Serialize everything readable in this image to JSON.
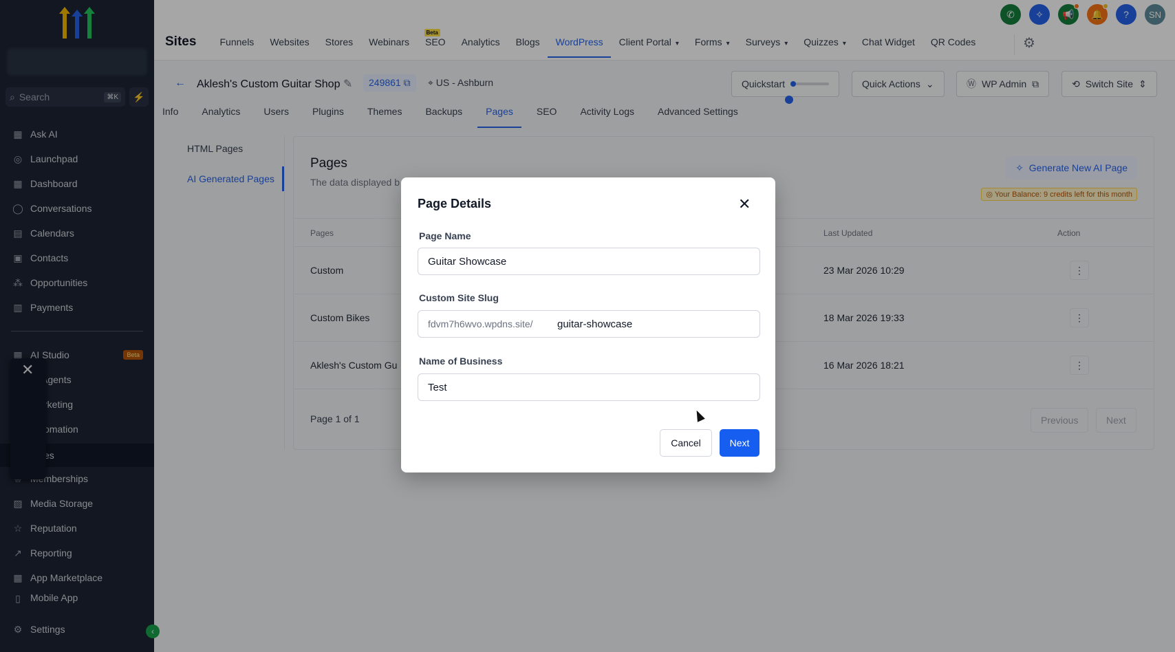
{
  "sidebar": {
    "search_placeholder": "Search",
    "search_shortcut": "⌘K",
    "items": [
      {
        "label": "Ask AI",
        "icon": "grid-icon"
      },
      {
        "label": "Launchpad",
        "icon": "rocket-icon"
      },
      {
        "label": "Dashboard",
        "icon": "grid-icon"
      },
      {
        "label": "Conversations",
        "icon": "chat-icon"
      },
      {
        "label": "Calendars",
        "icon": "calendar-icon"
      },
      {
        "label": "Contacts",
        "icon": "contacts-icon"
      },
      {
        "label": "Opportunities",
        "icon": "opportunities-icon"
      },
      {
        "label": "Payments",
        "icon": "payments-icon"
      }
    ],
    "ai_studio": {
      "label": "AI Studio",
      "badge": "Beta"
    },
    "partial_items": [
      "Agents",
      "rketing",
      "omation",
      "es"
    ],
    "items2": [
      {
        "label": "Memberships",
        "icon": "membership-icon"
      },
      {
        "label": "Media Storage",
        "icon": "image-icon"
      },
      {
        "label": "Reputation",
        "icon": "star-icon"
      },
      {
        "label": "Reporting",
        "icon": "chart-icon"
      },
      {
        "label": "App Marketplace",
        "icon": "grid-icon"
      },
      {
        "label": "Mobile App",
        "icon": "mobile-icon"
      }
    ],
    "settings": "Settings"
  },
  "topbar": {
    "title": "Sites",
    "tabs": [
      {
        "label": "Funnels"
      },
      {
        "label": "Websites"
      },
      {
        "label": "Stores"
      },
      {
        "label": "Webinars"
      },
      {
        "label": "SEO",
        "badge": "Beta"
      },
      {
        "label": "Analytics"
      },
      {
        "label": "Blogs"
      },
      {
        "label": "WordPress",
        "active": true
      },
      {
        "label": "Client Portal",
        "dropdown": true
      },
      {
        "label": "Forms",
        "dropdown": true
      },
      {
        "label": "Surveys",
        "dropdown": true
      },
      {
        "label": "Quizzes",
        "dropdown": true
      },
      {
        "label": "Chat Widget"
      },
      {
        "label": "QR Codes"
      }
    ],
    "avatar": "SN",
    "colors": {
      "phone": "#15803d",
      "ai": "#2563eb",
      "megaphone": "#15803d",
      "bell": "#f97316",
      "help": "#2563eb",
      "avatar": "#5f8d9b"
    }
  },
  "site": {
    "name": "Aklesh's Custom Guitar Shop",
    "id": "249861",
    "location": "US - Ashburn",
    "quickstart": "Quickstart",
    "quickstart_progress": 0.1,
    "quick_actions": "Quick Actions",
    "wp_admin": "WP Admin",
    "switch_site": "Switch Site",
    "tabs": [
      "Info",
      "Analytics",
      "Users",
      "Plugins",
      "Themes",
      "Backups",
      "Pages",
      "SEO",
      "Activity Logs",
      "Advanced Settings"
    ],
    "active_tab": "Pages"
  },
  "pages_panel": {
    "left_nav": [
      "HTML Pages",
      "AI Generated Pages"
    ],
    "title": "Pages",
    "subtitle": "The data displayed b",
    "generate_button": "Generate New AI Page",
    "balance": "Your Balance: 9 credits left for this month",
    "columns": [
      "Pages",
      "Last Updated",
      "Action"
    ],
    "rows": [
      {
        "name": "Custom",
        "updated": "23 Mar 2026 10:29"
      },
      {
        "name": "Custom Bikes",
        "updated": "18 Mar 2026 19:33"
      },
      {
        "name": "Aklesh's Custom Gu",
        "updated": "16 Mar 2026 18:21"
      }
    ],
    "pagination": "Page 1 of 1",
    "previous": "Previous",
    "next": "Next"
  },
  "modal": {
    "title": "Page Details",
    "page_name_label": "Page Name",
    "page_name_value": "Guitar Showcase",
    "slug_label": "Custom Site Slug",
    "slug_prefix": "fdvm7h6wvo.wpdns.site/",
    "slug_value": "guitar-showcase",
    "business_label": "Name of Business",
    "business_value": "Test",
    "cancel": "Cancel",
    "next": "Next"
  }
}
